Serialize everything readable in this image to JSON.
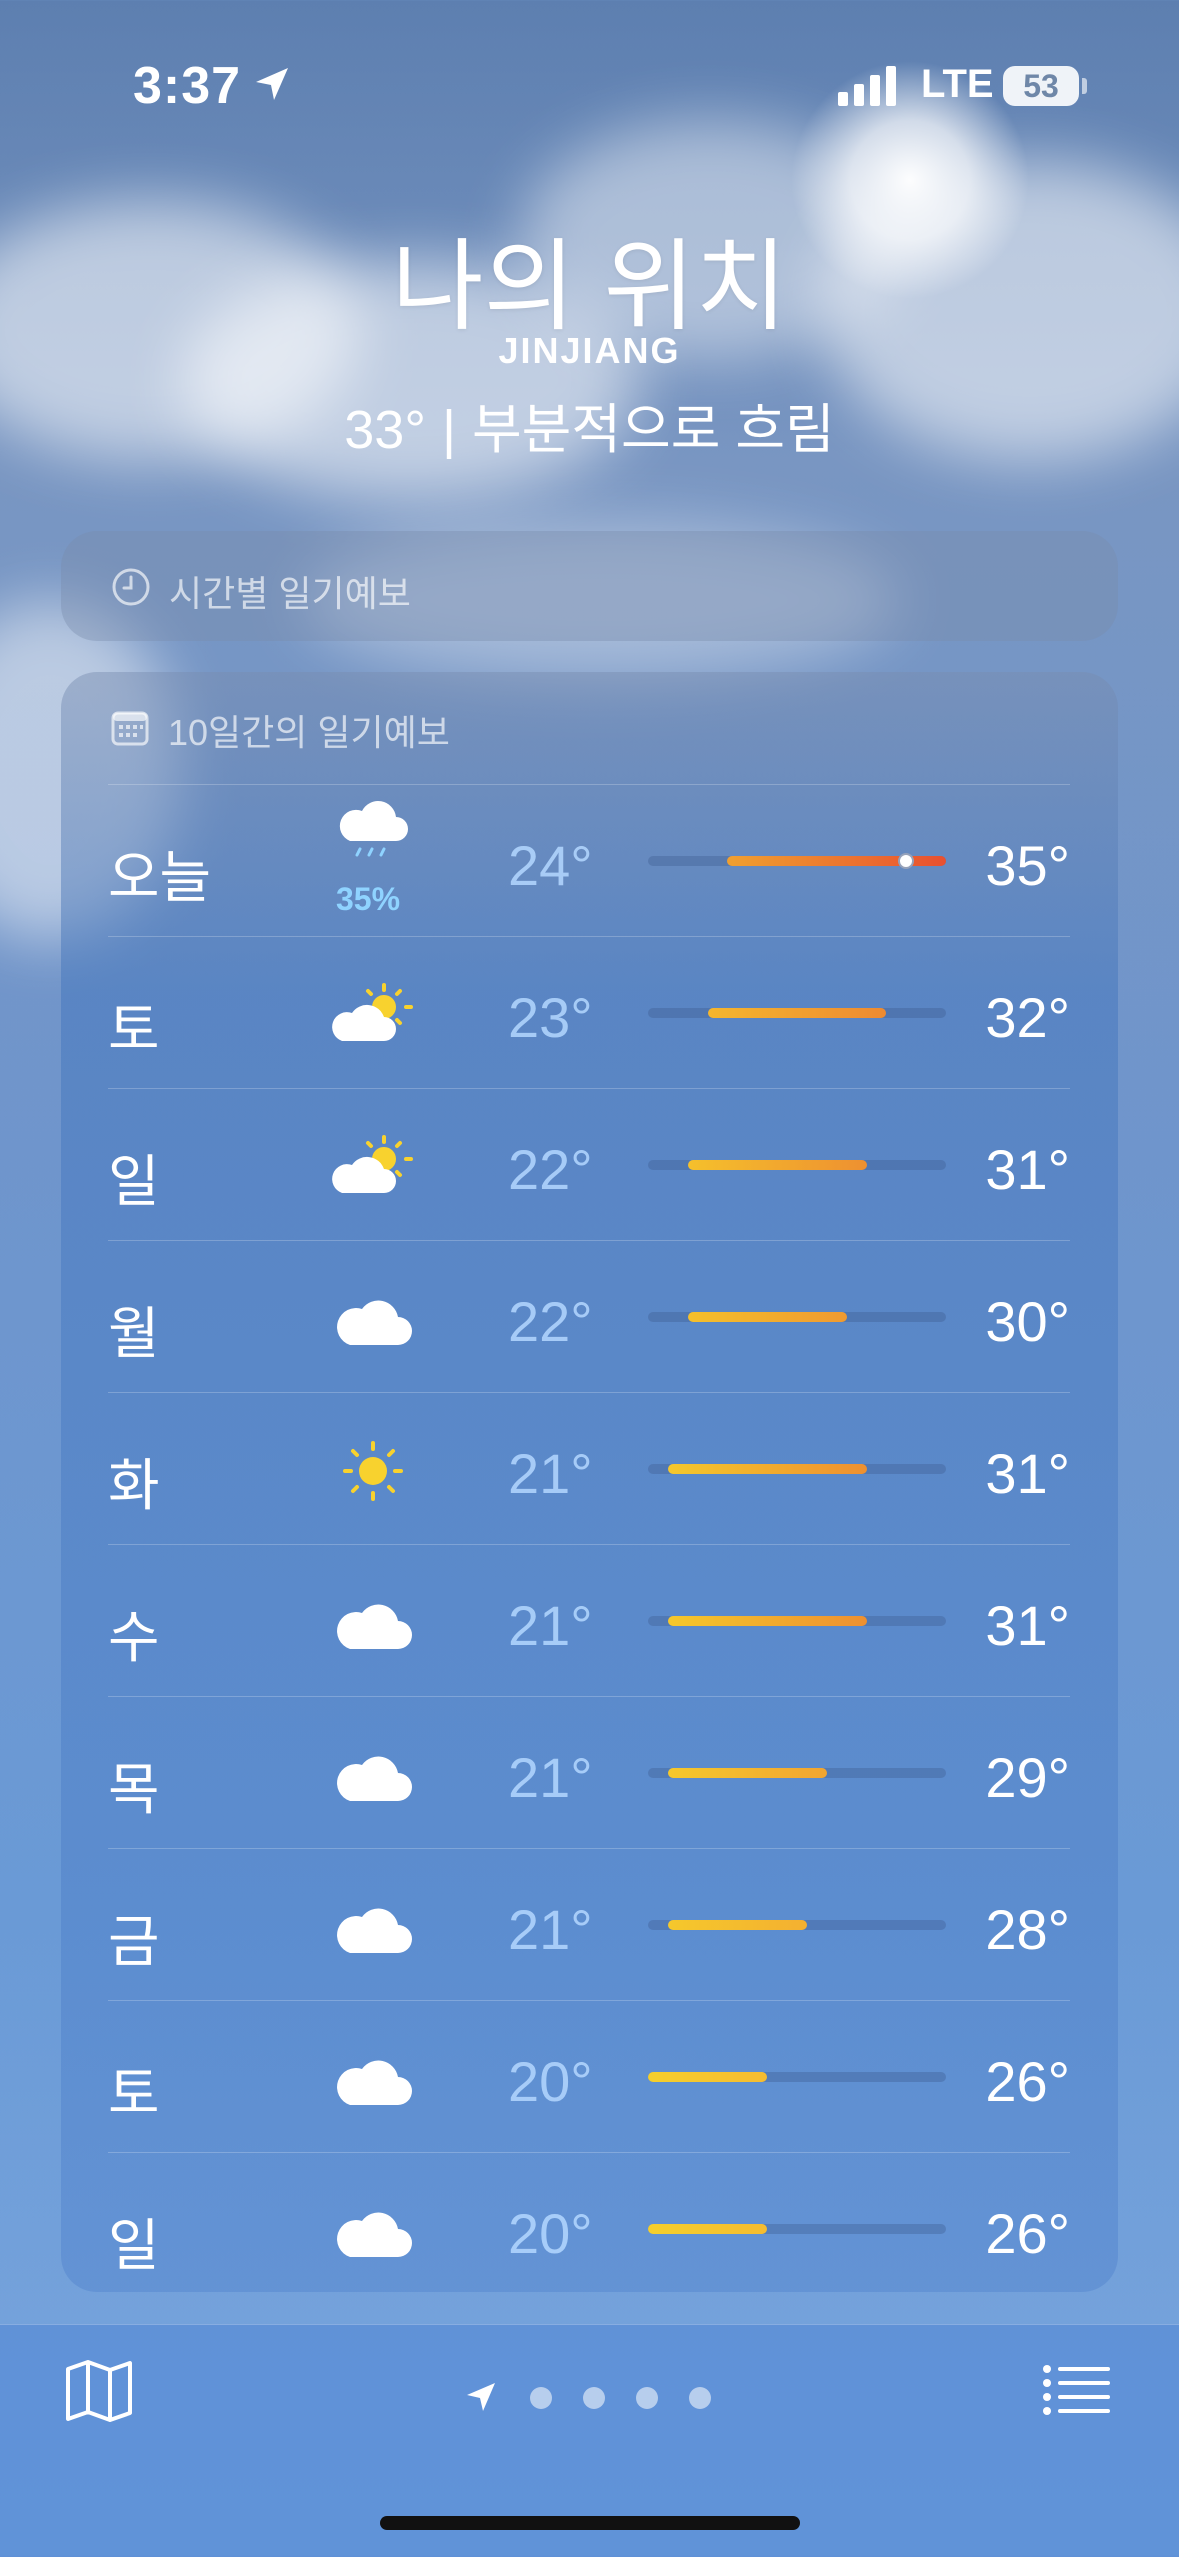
{
  "status_bar": {
    "time": "3:37",
    "network": "LTE",
    "battery": "53"
  },
  "header": {
    "title": "나의 위치",
    "city": "JINJIANG",
    "current_temp": "33°",
    "separator": "|",
    "condition": "부분적으로 흐림"
  },
  "hourly": {
    "label": "시간별 일기예보"
  },
  "daily": {
    "label": "10일간의 일기예보",
    "scale": {
      "min": 20,
      "max": 35
    },
    "days": [
      {
        "day": "오늘",
        "icon": "rain-cloud-icon",
        "precip": "35%",
        "low": "24°",
        "high": "35°",
        "low_val": 24,
        "high_val": 35,
        "now_val": 33,
        "colors": [
          "#f0a030",
          "#e85030"
        ]
      },
      {
        "day": "토",
        "icon": "partly-sunny-icon",
        "precip": "",
        "low": "23°",
        "high": "32°",
        "low_val": 23,
        "high_val": 32,
        "colors": [
          "#f5b62e",
          "#ee8a30"
        ]
      },
      {
        "day": "일",
        "icon": "partly-sunny-icon",
        "precip": "",
        "low": "22°",
        "high": "31°",
        "low_val": 22,
        "high_val": 31,
        "colors": [
          "#f5c02c",
          "#ee9030"
        ]
      },
      {
        "day": "월",
        "icon": "cloud-icon",
        "precip": "",
        "low": "22°",
        "high": "30°",
        "low_val": 22,
        "high_val": 30,
        "colors": [
          "#f5c02c",
          "#f09a30"
        ]
      },
      {
        "day": "화",
        "icon": "sun-icon",
        "precip": "",
        "low": "21°",
        "high": "31°",
        "low_val": 21,
        "high_val": 31,
        "colors": [
          "#f5c82c",
          "#ee9030"
        ]
      },
      {
        "day": "수",
        "icon": "cloud-icon",
        "precip": "",
        "low": "21°",
        "high": "31°",
        "low_val": 21,
        "high_val": 31,
        "colors": [
          "#f5c82c",
          "#ee9030"
        ]
      },
      {
        "day": "목",
        "icon": "cloud-icon",
        "precip": "",
        "low": "21°",
        "high": "29°",
        "low_val": 21,
        "high_val": 29,
        "colors": [
          "#f5c82c",
          "#f2a530"
        ]
      },
      {
        "day": "금",
        "icon": "cloud-icon",
        "precip": "",
        "low": "21°",
        "high": "28°",
        "low_val": 21,
        "high_val": 28,
        "colors": [
          "#f5c82c",
          "#f4b030"
        ]
      },
      {
        "day": "토",
        "icon": "cloud-icon",
        "precip": "",
        "low": "20°",
        "high": "26°",
        "low_val": 20,
        "high_val": 26,
        "colors": [
          "#f5cf2c",
          "#f5bc30"
        ]
      },
      {
        "day": "일",
        "icon": "cloud-icon",
        "precip": "",
        "low": "20°",
        "high": "26°",
        "low_val": 20,
        "high_val": 26,
        "colors": [
          "#f5cf2c",
          "#f5bc30"
        ]
      }
    ]
  },
  "toolbar": {
    "page_count": 4,
    "active_page": 0
  }
}
